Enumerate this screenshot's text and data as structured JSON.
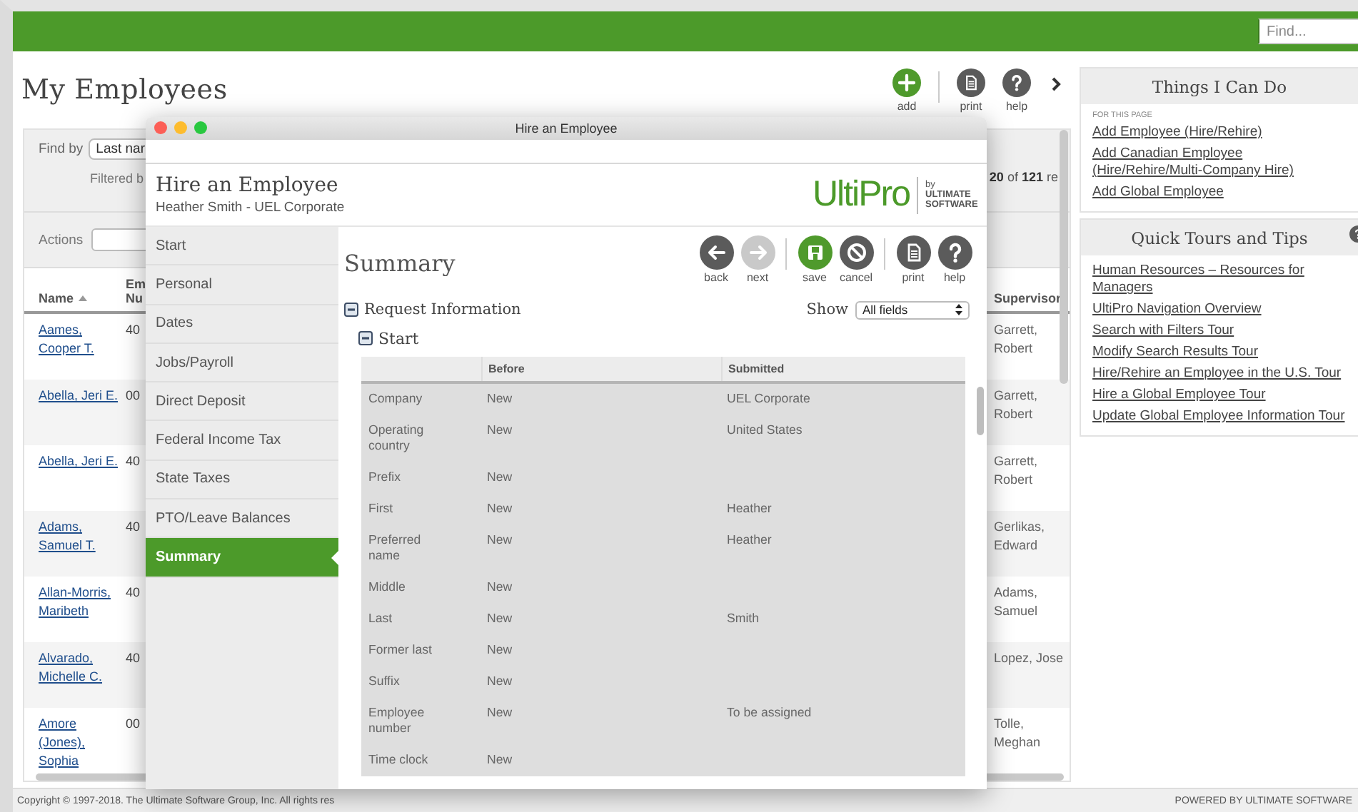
{
  "topbar": {
    "search": {
      "placeholder": "Find..."
    }
  },
  "page": {
    "title": "My Employees",
    "actions": [
      {
        "kind": "add",
        "label": "add"
      },
      {
        "kind": "print",
        "label": "print"
      },
      {
        "kind": "help",
        "label": "help"
      }
    ]
  },
  "filters": {
    "find_by_label": "Find by",
    "find_by_value": "Last nar",
    "filtered_label": "Filtered b",
    "count": "**20** of **121** re",
    "actions_label": "Actions"
  },
  "employee_table": {
    "columns": [
      {
        "label": "Name",
        "sorted": true
      },
      {
        "label": "Em Nu",
        "sorted": false
      },
      {
        "label": "Supervisor",
        "sorted": false
      }
    ],
    "rows": [
      {
        "name": "Aames, Cooper T.",
        "number": "40",
        "supervisor": "Garrett, Robert"
      },
      {
        "name": "Abella, Jeri E.",
        "number": "00",
        "supervisor": "Garrett, Robert"
      },
      {
        "name": "Abella, Jeri E.",
        "number": "40",
        "supervisor": "Garrett, Robert"
      },
      {
        "name": "Adams, Samuel T.",
        "number": "40",
        "supervisor": "Gerlikas, Edward"
      },
      {
        "name": "Allan-Morris, Maribeth",
        "number": "40",
        "supervisor": "Adams, Samuel"
      },
      {
        "name": "Alvarado, Michelle C.",
        "number": "40",
        "supervisor": "Lopez, Jose"
      },
      {
        "name": "Amore (Jones), Sophia",
        "number": "00",
        "supervisor": "Tolle, Meghan"
      }
    ]
  },
  "things_i_can_do": {
    "title": "Things I Can Do",
    "caption": "FOR THIS PAGE",
    "links": [
      "Add Employee (Hire/Rehire)",
      "Add Canadian Employee (Hire/Rehire/Multi-Company Hire)",
      "Add Global Employee"
    ]
  },
  "quick_tours": {
    "title": "Quick Tours and Tips",
    "links": [
      "Human Resources – Resources for Managers",
      "UltiPro Navigation Overview",
      "Search with Filters Tour",
      "Modify Search Results Tour",
      "Hire/Rehire an Employee in the U.S. Tour",
      "Hire a Global Employee Tour",
      "Update Global Employee Information Tour"
    ]
  },
  "modal": {
    "title": "Hire an Employee",
    "heading": "Hire an Employee",
    "subheading": "Heather Smith - UEL Corporate",
    "logo": {
      "name": "UltiPro",
      "by": "by",
      "company": "ULTIMATE SOFTWARE"
    },
    "nav": [
      {
        "label": "Start",
        "selected": false
      },
      {
        "label": "Personal",
        "selected": false
      },
      {
        "label": "Dates",
        "selected": false
      },
      {
        "label": "Jobs/Payroll",
        "selected": false
      },
      {
        "label": "Direct Deposit",
        "selected": false
      },
      {
        "label": "Federal Income Tax",
        "selected": false
      },
      {
        "label": "State Taxes",
        "selected": false
      },
      {
        "label": "PTO/Leave Balances",
        "selected": false
      },
      {
        "label": "Summary",
        "selected": true
      }
    ],
    "content": {
      "title": "Summary",
      "tools": [
        {
          "kind": "back",
          "label": "back",
          "disabled": false,
          "separator_before": false
        },
        {
          "kind": "next",
          "label": "next",
          "disabled": true,
          "separator_before": false
        },
        {
          "kind": "save",
          "label": "save",
          "disabled": false,
          "separator_before": true
        },
        {
          "kind": "cancel",
          "label": "cancel",
          "disabled": false,
          "separator_before": false
        },
        {
          "kind": "print",
          "label": "print",
          "disabled": false,
          "separator_before": true
        },
        {
          "kind": "help",
          "label": "help",
          "disabled": false,
          "separator_before": false
        }
      ],
      "section": "Request Information",
      "show_label": "Show",
      "show_value": "All fields",
      "subsection": "Start",
      "table": {
        "columns": [
          "Before",
          "Submitted"
        ],
        "rows": [
          {
            "field": "Company",
            "before": "New",
            "submitted": "UEL Corporate"
          },
          {
            "field": "Operating country",
            "before": "New",
            "submitted": "United States"
          },
          {
            "field": "Prefix",
            "before": "New"
          },
          {
            "field": "First",
            "before": "New",
            "submitted": "Heather"
          },
          {
            "field": "Preferred name",
            "before": "New",
            "submitted": "Heather"
          },
          {
            "field": "Middle",
            "before": "New"
          },
          {
            "field": "Last",
            "before": "New",
            "submitted": "Smith"
          },
          {
            "field": "Former last",
            "before": "New"
          },
          {
            "field": "Suffix",
            "before": "New"
          },
          {
            "field": "Employee number",
            "before": "New",
            "submitted": "To be assigned"
          },
          {
            "field": "Time clock",
            "before": "New"
          }
        ]
      }
    }
  },
  "footer": {
    "copyright": "Copyright © 1997-2018. The Ultimate Software Group, Inc. All rights res",
    "powered_by": "POWERED BY ULTIMATE SOFTWARE"
  }
}
